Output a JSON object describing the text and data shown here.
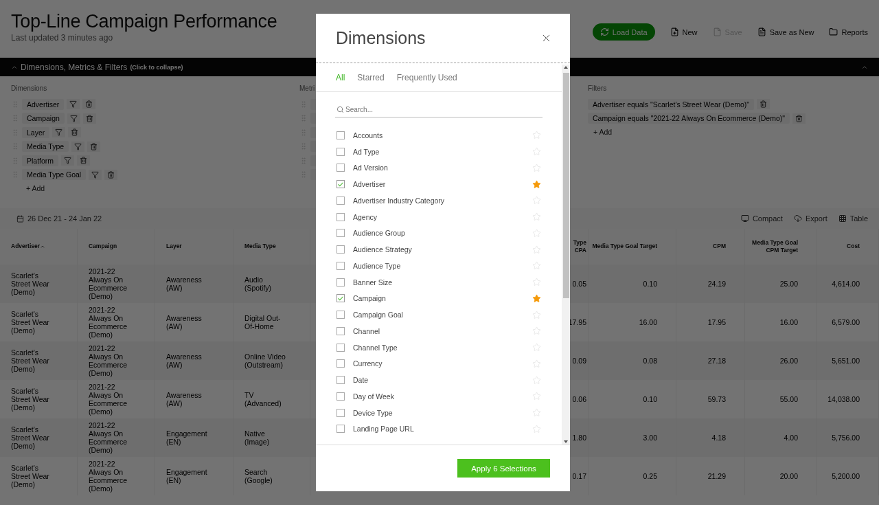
{
  "header": {
    "title": "Top-Line Campaign Performance",
    "subtitle": "Last updated 3 minutes ago"
  },
  "toolbar": [
    {
      "label": "Load Data",
      "kind": "primary",
      "disabled": false
    },
    {
      "label": "New",
      "kind": "action",
      "disabled": false
    },
    {
      "label": "Save",
      "kind": "action",
      "disabled": true
    },
    {
      "label": "Save as New",
      "kind": "action",
      "disabled": false
    },
    {
      "label": "Reports",
      "kind": "action",
      "disabled": false
    }
  ],
  "panel_bar": {
    "title": "Dimensions, Metrics & Filters",
    "hint": "(Click to collapse)",
    "expanded": true
  },
  "dimensions": {
    "label": "Dimensions",
    "items": [
      "Advertiser",
      "Campaign",
      "Layer",
      "Media Type",
      "Platform",
      "Media Type Goal"
    ],
    "add": "+ Add"
  },
  "metrics": {
    "label": "Metri"
  },
  "filters": {
    "label": "Filters",
    "items": [
      "Advertiser equals \"Scarlet's Street Wear (Demo)\"",
      "Campaign equals \"2021-22 Always On Ecommerce (Demo)\""
    ],
    "add": "+ Add"
  },
  "report_toolbar": {
    "date_range": "26 Dec 21 - 24 Jan 22",
    "actions": [
      "Compact",
      "Export",
      "Table"
    ]
  },
  "table": {
    "columns": [
      {
        "label": "Advertiser",
        "sorted": true
      },
      {
        "label": "Campaign",
        "sorted": false
      },
      {
        "label": "Layer",
        "sorted": false
      },
      {
        "label": "Media Type",
        "sorted": false
      },
      {
        "label": "Type CPA",
        "sorted": false
      },
      {
        "label": "Media Type Goal Target",
        "sorted": false
      },
      {
        "label": "CPM",
        "sorted": false
      },
      {
        "label": "Media Type Goal CPM Target",
        "sorted": false
      },
      {
        "label": "Cost",
        "sorted": false
      }
    ],
    "rows": [
      [
        "Scarlet's Street Wear (Demo)",
        "2021-22 Always On Ecommerce (Demo)",
        "Awareness (AW)",
        "Audio (Spotify)",
        "0.05",
        "0.10",
        "24.19",
        "25.00",
        "4,614.00"
      ],
      [
        "Scarlet's Street Wear (Demo)",
        "2021-22 Always On Ecommerce (Demo)",
        "Awareness (AW)",
        "Digital Out-Of-Home",
        "17.95",
        "16.00",
        "17.95",
        "16.00",
        "6,579.00"
      ],
      [
        "Scarlet's Street Wear (Demo)",
        "2021-22 Always On Ecommerce (Demo)",
        "Awareness (AW)",
        "Online Video (Outstream)",
        "0.09",
        "0.08",
        "27.18",
        "26.00",
        "5,651.00"
      ],
      [
        "Scarlet's Street Wear (Demo)",
        "2021-22 Always On Ecommerce (Demo)",
        "Awareness (AW)",
        "TV (Advanced)",
        "0.06",
        "0.10",
        "59.73",
        "55.00",
        "14,038.00"
      ],
      [
        "Scarlet's Street Wear (Demo)",
        "2021-22 Always On Ecommerce (Demo)",
        "Engagement (EN)",
        "Native (Image)",
        "1.80",
        "3.00",
        "4.18",
        "4.00",
        "5,756.00"
      ],
      [
        "Scarlet's Street Wear (Demo)",
        "2021-22 Always On Ecommerce (Demo)",
        "Engagement (EN)",
        "Search (Google)",
        "0.17",
        "0.25",
        "21.29",
        "20.00",
        "5,200.00"
      ]
    ]
  },
  "modal": {
    "title": "Dimensions",
    "tabs": [
      {
        "label": "All",
        "selected": true
      },
      {
        "label": "Starred",
        "selected": false
      },
      {
        "label": "Frequently Used",
        "selected": false
      }
    ],
    "search": {
      "placeholder": "Search..."
    },
    "items": [
      {
        "label": "Accounts",
        "checked": false,
        "starred": false
      },
      {
        "label": "Ad Type",
        "checked": false,
        "starred": false
      },
      {
        "label": "Ad Version",
        "checked": false,
        "starred": false
      },
      {
        "label": "Advertiser",
        "checked": true,
        "starred": true
      },
      {
        "label": "Advertiser Industry Category",
        "checked": false,
        "starred": false
      },
      {
        "label": "Agency",
        "checked": false,
        "starred": false
      },
      {
        "label": "Audience Group",
        "checked": false,
        "starred": false
      },
      {
        "label": "Audience Strategy",
        "checked": false,
        "starred": false
      },
      {
        "label": "Audience Type",
        "checked": false,
        "starred": false
      },
      {
        "label": "Banner Size",
        "checked": false,
        "starred": false
      },
      {
        "label": "Campaign",
        "checked": true,
        "starred": true
      },
      {
        "label": "Campaign Goal",
        "checked": false,
        "starred": false
      },
      {
        "label": "Channel",
        "checked": false,
        "starred": false
      },
      {
        "label": "Channel Type",
        "checked": false,
        "starred": false
      },
      {
        "label": "Currency",
        "checked": false,
        "starred": false
      },
      {
        "label": "Date",
        "checked": false,
        "starred": false
      },
      {
        "label": "Day of Week",
        "checked": false,
        "starred": false
      },
      {
        "label": "Device Type",
        "checked": false,
        "starred": false
      },
      {
        "label": "Landing Page URL",
        "checked": false,
        "starred": false
      }
    ],
    "apply": "Apply 6 Selections"
  }
}
